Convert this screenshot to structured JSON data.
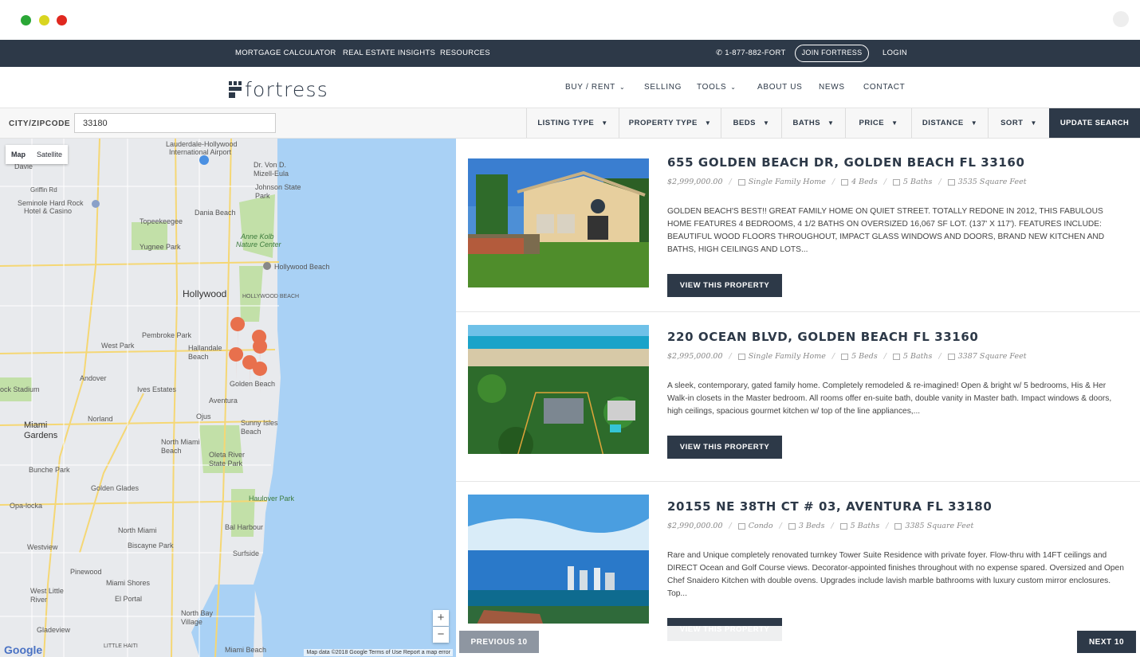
{
  "topbar": {
    "links": [
      "MORTGAGE CALCULATOR",
      "REAL ESTATE INSIGHTS",
      "RESOURCES"
    ],
    "phone": "1-877-882-FORT",
    "join": "JOIN FORTRESS",
    "login": "LOGIN"
  },
  "nav": {
    "logo": "fortress",
    "items": [
      "BUY / RENT",
      "SELLING",
      "TOOLS",
      "ABOUT US",
      "NEWS",
      "CONTACT"
    ]
  },
  "search": {
    "city_label": "CITY/ZIPCODE",
    "city_value": "33180",
    "filters": [
      "LISTING TYPE",
      "PROPERTY TYPE",
      "BEDS",
      "BATHS",
      "PRICE",
      "DISTANCE",
      "SORT"
    ],
    "update": "UPDATE SEARCH"
  },
  "map": {
    "toggle_map": "Map",
    "toggle_satellite": "Satellite",
    "zoom_in": "+",
    "zoom_out": "−",
    "attribution": "Map data ©2018 Google   Terms of Use   Report a map error",
    "google": "Google",
    "labels": [
      "Davie",
      "Lauderdale-Hollywood",
      "International Airport",
      "Dr. Von D. Mizell-Eula",
      "Johnson State Park",
      "Griffin Rd",
      "Seminole Hard Rock",
      "Hotel & Casino",
      "Dania Beach",
      "Topeekeegee",
      "Yugnee Park",
      "Anne Kolb",
      "Nature Center",
      "Hollywood Beach",
      "Hollywood",
      "HOLLYWOOD BEACH",
      "Pembroke Park",
      "West Park",
      "Hallandale Beach",
      "Andover",
      "Ives Estates",
      "Golden Beach",
      "Aventura",
      "Ojus",
      "Norland",
      "Sunny Isles Beach",
      "Miami Gardens",
      "North Miami Beach",
      "Oleta River State Park",
      "Bunche Park",
      "Golden Glades",
      "Opa-locka",
      "Haulover Park",
      "North Miami",
      "Bal Harbour",
      "Westview",
      "Biscayne Park",
      "Surfside",
      "Pinewood",
      "Miami Shores",
      "West Little River",
      "El Portal",
      "North Bay Village",
      "Gladeview",
      "Miami Beach",
      "ock Stadium",
      "LITTLE HAITI"
    ]
  },
  "listings": [
    {
      "title": "655 GOLDEN BEACH DR, GOLDEN BEACH FL 33160",
      "price": "$2,999,000.00",
      "type": "Single Family Home",
      "beds": "4 Beds",
      "baths": "5 Baths",
      "sqft": "3535 Square Feet",
      "desc": "GOLDEN BEACH'S BEST!! GREAT FAMILY HOME ON QUIET STREET. TOTALLY REDONE IN 2012, THIS FABULOUS HOME FEATURES 4 BEDROOMS, 4 1/2 BATHS ON OVERSIZED 16,067 SF LOT. (137' X 117'). FEATURES INCLUDE: BEAUTIFUL WOOD FLOORS THROUGHOUT, IMPACT GLASS WINDOWS AND DOORS, BRAND NEW KITCHEN AND BATHS, HIGH CEILINGS AND LOTS...",
      "button": "VIEW THIS PROPERTY"
    },
    {
      "title": "220 OCEAN BLVD, GOLDEN BEACH FL 33160",
      "price": "$2,995,000.00",
      "type": "Single Family Home",
      "beds": "5 Beds",
      "baths": "5 Baths",
      "sqft": "3387 Square Feet",
      "desc": "A sleek, contemporary, gated family home. Completely remodeled & re-imagined! Open & bright w/ 5 bedrooms, His & Her Walk-in closets in the Master bedroom. All rooms offer en-suite bath, double vanity in Master bath. Impact windows & doors, high ceilings, spacious gourmet kitchen w/ top of the line appliances,...",
      "button": "VIEW THIS PROPERTY"
    },
    {
      "title": "20155 NE 38TH CT # 03, AVENTURA FL 33180",
      "price": "$2,990,000.00",
      "type": "Condo",
      "beds": "3 Beds",
      "baths": "5 Baths",
      "sqft": "3385 Square Feet",
      "desc": "Rare and Unique completely renovated turnkey Tower Suite Residence with private foyer. Flow-thru with 14FT ceilings and DIRECT Ocean and Golf Course views. Decorator-appointed finishes throughout with no expense spared. Oversized and Open Chef Snaidero Kitchen with double ovens. Upgrades include lavish marble bathrooms with luxury custom mirror enclosures. Top...",
      "button": "VIEW THIS PROPERTY"
    }
  ],
  "pager": {
    "prev": "PREVIOUS 10",
    "next": "NEXT 10"
  }
}
